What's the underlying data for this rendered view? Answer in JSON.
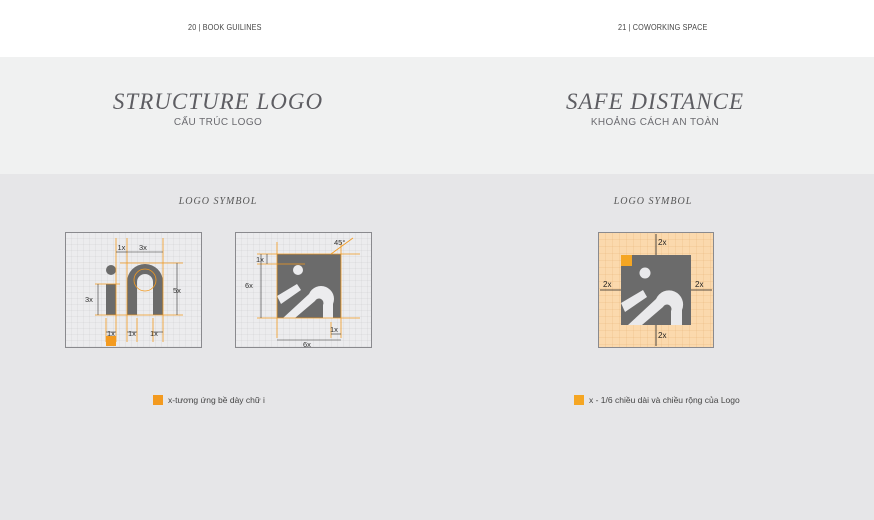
{
  "header": {
    "left": "20 | BOOK GUILINES",
    "right": "21 | COWORKING SPACE"
  },
  "left_page": {
    "title": "STRUCTURE LOGO",
    "subtitle": "CẤU TRÚC LOGO",
    "section": "LOGO SYMBOL",
    "legend": "x-tương ứng bề dày chữ i",
    "fig1_labels": {
      "a": "1x",
      "b": "3x",
      "c": "3x",
      "d": "5x",
      "e": "1x",
      "f": "1x",
      "g": "1x"
    },
    "fig2_labels": {
      "angle": "45°",
      "a": "1x",
      "b": "6x",
      "c": "1x",
      "d": "6x"
    }
  },
  "right_page": {
    "title": "SAFE DISTANCE",
    "subtitle": "KHOẢNG CÁCH AN TOÀN",
    "section": "LOGO SYMBOL",
    "legend": "x - 1/6 chiều dài và chiều rộng của Logo",
    "fig_labels": {
      "top": "2x",
      "left": "2x",
      "right": "2x",
      "bottom": "2x"
    }
  },
  "colors": {
    "accent": "#f39a1f",
    "logo": "#6b6b6b",
    "safe_zone": "#fbd9ad"
  }
}
